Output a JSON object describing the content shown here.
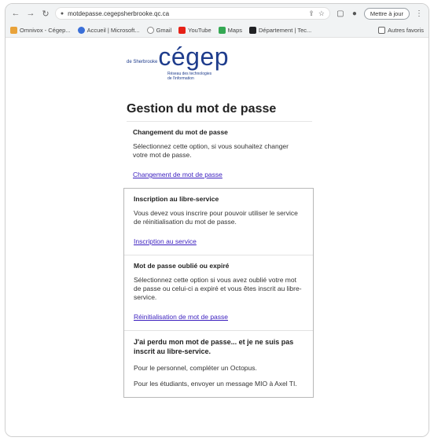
{
  "browser": {
    "url": "motdepasse.cegepsherbrooke.qc.ca",
    "update_label": "Mettre à jour",
    "bookmarks": [
      {
        "label": "Omnivox - Cégep...",
        "color": "#e8a23a"
      },
      {
        "label": "Accueil | Microsoft...",
        "color": "#3a6fd8"
      },
      {
        "label": "Gmail",
        "color": "#d44638"
      },
      {
        "label": "YouTube",
        "color": "#e62117"
      },
      {
        "label": "Maps",
        "color": "#34a853"
      },
      {
        "label": "Département | Tec...",
        "color": "#202124"
      }
    ],
    "other_bookmarks": "Autres favoris"
  },
  "logo": {
    "prefix": "de Sherbrooke",
    "name": "cégep",
    "tagline": "Réseau des technologies de l'information"
  },
  "page": {
    "title": "Gestion du mot de passe"
  },
  "sections": {
    "change": {
      "title": "Changement du mot de passe",
      "text": "Sélectionnez cette option, si vous souhaitez changer votre mot de passe.",
      "link": "Changement de mot de passe"
    },
    "register": {
      "title": "Inscription au libre-service",
      "text": "Vous devez vous inscrire pour pouvoir utiliser le service de réinitialisation du mot de passe.",
      "link": "Inscription au service"
    },
    "forgot": {
      "title": "Mot de passe oublié ou expiré",
      "text": "Sélectionnez cette option si vous avez oublié votre mot de passe ou celui-ci a expiré et vous êtes inscrit au libre-service.",
      "link": "Réinitialisation de mot de passe"
    },
    "not_registered": {
      "title": "J'ai perdu mon mot de passe... et je ne suis pas inscrit au libre-service.",
      "staff": "Pour le personnel, compléter un Octopus.",
      "students": "Pour les étudiants, envoyer un message MIO à Axel TI."
    }
  }
}
